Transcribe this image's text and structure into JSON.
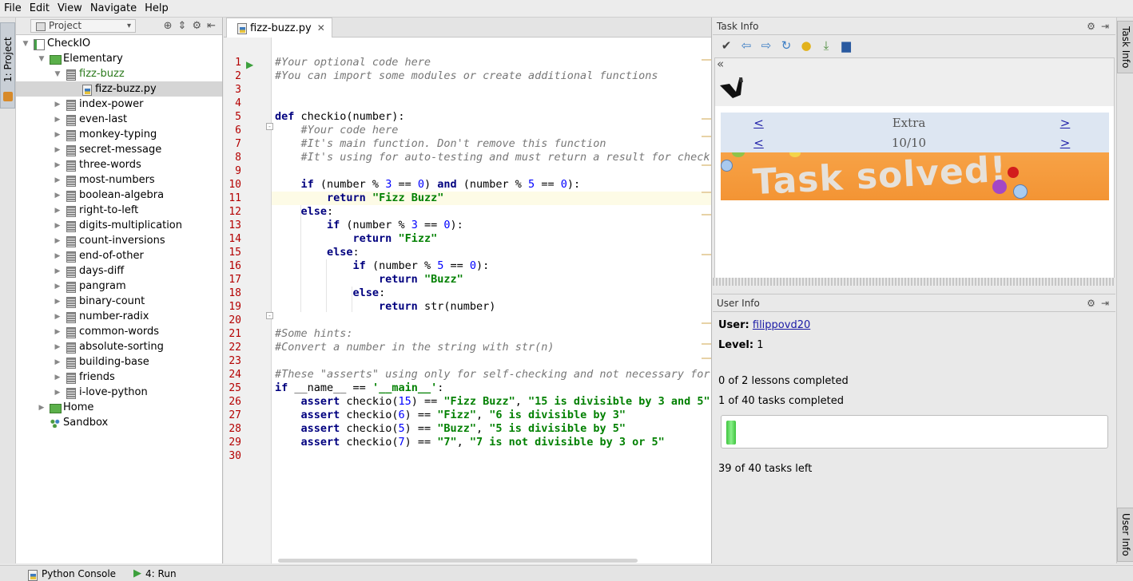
{
  "menu": [
    {
      "label": "File"
    },
    {
      "label": "Edit"
    },
    {
      "label": "View"
    },
    {
      "label": "Navigate"
    },
    {
      "label": "Help"
    }
  ],
  "left_strip": {
    "tab_label": "1: Project"
  },
  "right_strip": {
    "task_tab_label": "Task Info",
    "user_tab_label": "User Info"
  },
  "project": {
    "view_selector": "Project",
    "tree": [
      {
        "label": "CheckIO",
        "depth": 0,
        "arrow": "▼",
        "icon": "proj"
      },
      {
        "label": "Elementary",
        "depth": 1,
        "arrow": "▼",
        "icon": "green"
      },
      {
        "label": "fizz-buzz",
        "depth": 2,
        "arrow": "▼",
        "icon": "mod",
        "green": true
      },
      {
        "label": "fizz-buzz.py",
        "depth": 3,
        "arrow": "",
        "icon": "py",
        "selected": true
      },
      {
        "label": "index-power",
        "depth": 2,
        "arrow": "▶",
        "icon": "mod"
      },
      {
        "label": "even-last",
        "depth": 2,
        "arrow": "▶",
        "icon": "mod"
      },
      {
        "label": "monkey-typing",
        "depth": 2,
        "arrow": "▶",
        "icon": "mod"
      },
      {
        "label": "secret-message",
        "depth": 2,
        "arrow": "▶",
        "icon": "mod"
      },
      {
        "label": "three-words",
        "depth": 2,
        "arrow": "▶",
        "icon": "mod"
      },
      {
        "label": "most-numbers",
        "depth": 2,
        "arrow": "▶",
        "icon": "mod"
      },
      {
        "label": "boolean-algebra",
        "depth": 2,
        "arrow": "▶",
        "icon": "mod"
      },
      {
        "label": "right-to-left",
        "depth": 2,
        "arrow": "▶",
        "icon": "mod"
      },
      {
        "label": "digits-multiplication",
        "depth": 2,
        "arrow": "▶",
        "icon": "mod"
      },
      {
        "label": "count-inversions",
        "depth": 2,
        "arrow": "▶",
        "icon": "mod"
      },
      {
        "label": "end-of-other",
        "depth": 2,
        "arrow": "▶",
        "icon": "mod"
      },
      {
        "label": "days-diff",
        "depth": 2,
        "arrow": "▶",
        "icon": "mod"
      },
      {
        "label": "pangram",
        "depth": 2,
        "arrow": "▶",
        "icon": "mod"
      },
      {
        "label": "binary-count",
        "depth": 2,
        "arrow": "▶",
        "icon": "mod"
      },
      {
        "label": "number-radix",
        "depth": 2,
        "arrow": "▶",
        "icon": "mod"
      },
      {
        "label": "common-words",
        "depth": 2,
        "arrow": "▶",
        "icon": "mod"
      },
      {
        "label": "absolute-sorting",
        "depth": 2,
        "arrow": "▶",
        "icon": "mod"
      },
      {
        "label": "building-base",
        "depth": 2,
        "arrow": "▶",
        "icon": "mod"
      },
      {
        "label": "friends",
        "depth": 2,
        "arrow": "▶",
        "icon": "mod"
      },
      {
        "label": "i-love-python",
        "depth": 2,
        "arrow": "▶",
        "icon": "mod"
      },
      {
        "label": "Home",
        "depth": 1,
        "arrow": "▶",
        "icon": "green"
      },
      {
        "label": "Sandbox",
        "depth": 1,
        "arrow": "",
        "icon": "sand"
      }
    ]
  },
  "editor": {
    "tab_label": "fizz-buzz.py",
    "highlight_line": 11,
    "lines": [
      [
        [
          "cm",
          "#Your optional code here"
        ]
      ],
      [
        [
          "cm",
          "#You can import some modules or create additional functions"
        ]
      ],
      [],
      [],
      [
        [
          "kw",
          "def "
        ],
        [
          "",
          "checkio(number):"
        ]
      ],
      [
        [
          "",
          "    "
        ],
        [
          "cm",
          "#Your code here"
        ]
      ],
      [
        [
          "",
          "    "
        ],
        [
          "cm",
          "#It's main function. Don't remove this function"
        ]
      ],
      [
        [
          "",
          "    "
        ],
        [
          "cm",
          "#It's using for auto-testing and must return a result for check."
        ]
      ],
      [],
      [
        [
          "",
          "    "
        ],
        [
          "kw",
          "if "
        ],
        [
          "",
          "(number % "
        ],
        [
          "nm",
          "3"
        ],
        [
          "",
          " == "
        ],
        [
          "nm",
          "0"
        ],
        [
          "",
          ") "
        ],
        [
          "kw",
          "and "
        ],
        [
          "",
          "(number % "
        ],
        [
          "nm",
          "5"
        ],
        [
          "",
          " == "
        ],
        [
          "nm",
          "0"
        ],
        [
          "",
          "):"
        ]
      ],
      [
        [
          "",
          "        "
        ],
        [
          "kw",
          "return "
        ],
        [
          "st",
          "\"Fizz Buzz\""
        ]
      ],
      [
        [
          "",
          "    "
        ],
        [
          "kw",
          "else"
        ],
        [
          "",
          ":"
        ]
      ],
      [
        [
          "",
          "        "
        ],
        [
          "kw",
          "if "
        ],
        [
          "",
          "(number % "
        ],
        [
          "nm",
          "3"
        ],
        [
          "",
          " == "
        ],
        [
          "nm",
          "0"
        ],
        [
          "",
          "):"
        ]
      ],
      [
        [
          "",
          "            "
        ],
        [
          "kw",
          "return "
        ],
        [
          "st",
          "\"Fizz\""
        ]
      ],
      [
        [
          "",
          "        "
        ],
        [
          "kw",
          "else"
        ],
        [
          "",
          ":"
        ]
      ],
      [
        [
          "",
          "            "
        ],
        [
          "kw",
          "if "
        ],
        [
          "",
          "(number % "
        ],
        [
          "nm",
          "5"
        ],
        [
          "",
          " == "
        ],
        [
          "nm",
          "0"
        ],
        [
          "",
          "):"
        ]
      ],
      [
        [
          "",
          "                "
        ],
        [
          "kw",
          "return "
        ],
        [
          "st",
          "\"Buzz\""
        ]
      ],
      [
        [
          "",
          "            "
        ],
        [
          "kw",
          "else"
        ],
        [
          "",
          ":"
        ]
      ],
      [
        [
          "",
          "                "
        ],
        [
          "kw",
          "return "
        ],
        [
          "",
          "str(number)"
        ]
      ],
      [],
      [
        [
          "cm",
          "#Some hints:"
        ]
      ],
      [
        [
          "cm",
          "#Convert a number in the string with str(n)"
        ]
      ],
      [],
      [
        [
          "cm",
          "#These \"asserts\" using only for self-checking and not necessary for auto-testing"
        ]
      ],
      [
        [
          "kw",
          "if "
        ],
        [
          "",
          "__name__ == "
        ],
        [
          "st",
          "'__main__'"
        ],
        [
          "",
          ":"
        ]
      ],
      [
        [
          "",
          "    "
        ],
        [
          "kw",
          "assert "
        ],
        [
          "",
          "checkio("
        ],
        [
          "nm",
          "15"
        ],
        [
          "",
          ") == "
        ],
        [
          "st",
          "\"Fizz Buzz\""
        ],
        [
          "",
          ", "
        ],
        [
          "st",
          "\"15 is divisible by 3 and 5\""
        ]
      ],
      [
        [
          "",
          "    "
        ],
        [
          "kw",
          "assert "
        ],
        [
          "",
          "checkio("
        ],
        [
          "nm",
          "6"
        ],
        [
          "",
          ") == "
        ],
        [
          "st",
          "\"Fizz\""
        ],
        [
          "",
          ", "
        ],
        [
          "st",
          "\"6 is divisible by 3\""
        ]
      ],
      [
        [
          "",
          "    "
        ],
        [
          "kw",
          "assert "
        ],
        [
          "",
          "checkio("
        ],
        [
          "nm",
          "5"
        ],
        [
          "",
          ") == "
        ],
        [
          "st",
          "\"Buzz\""
        ],
        [
          "",
          ", "
        ],
        [
          "st",
          "\"5 is divisible by 5\""
        ]
      ],
      [
        [
          "",
          "    "
        ],
        [
          "kw",
          "assert "
        ],
        [
          "",
          "checkio("
        ],
        [
          "nm",
          "7"
        ],
        [
          "",
          ") == "
        ],
        [
          "st",
          "\"7\""
        ],
        [
          "",
          ", "
        ],
        [
          "st",
          "\"7 is not divisible by 3 or 5\""
        ]
      ],
      []
    ]
  },
  "task_info": {
    "title": "Task Info",
    "toolbar": [
      "check-icon",
      "prev-icon",
      "next-icon",
      "refresh-icon",
      "hint-icon",
      "download-icon",
      "upload-icon"
    ],
    "nav": {
      "prev": "<",
      "next": ">",
      "category": "Extra",
      "progress": "10/10"
    },
    "solved_text": "Task solved!"
  },
  "user_info": {
    "title": "User Info",
    "user_label": "User:",
    "user_name": "filippovd20",
    "level_label": "Level:",
    "level": "1",
    "lessons": "0 of 2 lessons completed",
    "tasks": "1 of 40 tasks completed",
    "tasks_progress": 0.025,
    "tasks_left": "39 of 40 tasks left"
  },
  "bottom": {
    "console_label": "Python Console",
    "run_label": "4: Run"
  },
  "colors": {
    "accent_green": "#3ec43e",
    "line_number": "#b40000",
    "solved_bg": "#f39434"
  }
}
